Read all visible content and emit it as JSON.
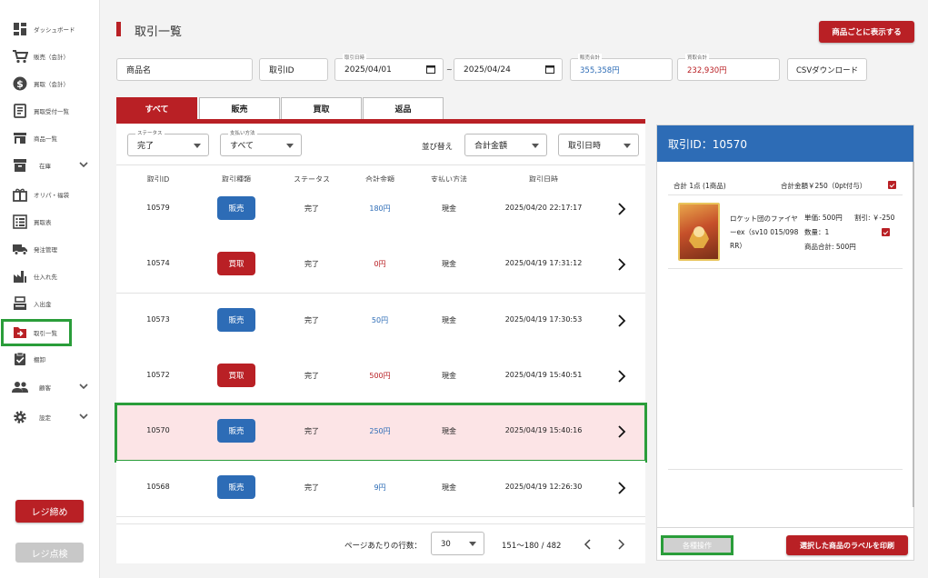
{
  "sidebar": {
    "items": [
      {
        "label": "ダッシュボード"
      },
      {
        "label": "販売（会計）"
      },
      {
        "label": "買取（会計）"
      },
      {
        "label": "買取受付一覧"
      },
      {
        "label": "商品一覧"
      },
      {
        "label": "在庫"
      },
      {
        "label": "オリパ・福袋"
      },
      {
        "label": "買取表"
      },
      {
        "label": "発注管理"
      },
      {
        "label": "仕入れ先"
      },
      {
        "label": "入出金"
      },
      {
        "label": "取引一覧"
      },
      {
        "label": "棚卸"
      },
      {
        "label": "顧客"
      },
      {
        "label": "設定"
      }
    ],
    "register_close_label": "レジ締め",
    "register_check_label": "レジ点検"
  },
  "header": {
    "title": "取引一覧",
    "show_by_product_label": "商品ごとに表示する"
  },
  "filters": {
    "product_name_placeholder": "商品名",
    "transaction_id_placeholder": "取引ID",
    "date_label": "取引日時",
    "date_from": "2025/04/01",
    "date_sep": "~",
    "date_to": "2025/04/24",
    "sales_total_label": "販売合計",
    "sales_total_value": "355,358円",
    "purchase_total_label": "買取合計",
    "purchase_total_value": "232,930円",
    "csv_label": "CSVダウンロード"
  },
  "tabs": [
    {
      "label": "すべて"
    },
    {
      "label": "販売"
    },
    {
      "label": "買取"
    },
    {
      "label": "返品"
    }
  ],
  "list_controls": {
    "status_label": "ステータス",
    "status_value": "完了",
    "payment_label": "支払い方法",
    "payment_value": "すべて",
    "sort_label": "並び替え",
    "sort_primary": "合計金額",
    "sort_secondary": "取引日時"
  },
  "table": {
    "headers": [
      "取引ID",
      "取引種類",
      "ステータス",
      "合計金額",
      "支払い方法",
      "取引日時"
    ],
    "rows": [
      {
        "id": "10579",
        "type": "販売",
        "status": "完了",
        "amount": "180円",
        "payment": "現金",
        "datetime": "2025/04/20 22:17:17"
      },
      {
        "id": "10574",
        "type": "買取",
        "status": "完了",
        "amount": "0円",
        "payment": "現金",
        "datetime": "2025/04/19 17:31:12"
      },
      {
        "id": "10573",
        "type": "販売",
        "status": "完了",
        "amount": "50円",
        "payment": "現金",
        "datetime": "2025/04/19 17:30:53"
      },
      {
        "id": "10572",
        "type": "買取",
        "status": "完了",
        "amount": "500円",
        "payment": "現金",
        "datetime": "2025/04/19 15:40:51"
      },
      {
        "id": "10570",
        "type": "販売",
        "status": "完了",
        "amount": "250円",
        "payment": "現金",
        "datetime": "2025/04/19 15:40:16"
      },
      {
        "id": "10568",
        "type": "販売",
        "status": "完了",
        "amount": "9円",
        "payment": "現金",
        "datetime": "2025/04/19 12:26:30"
      }
    ]
  },
  "pagination": {
    "rows_per_page_label": "ページあたりの行数：",
    "rows_per_page_value": "30",
    "range": "151〜180 / 482"
  },
  "detail": {
    "title": "取引ID：10570",
    "summary_count": "合計 1点 (1商品)",
    "summary_total": "合計金額￥250（0pt付与）",
    "item_name": "ロケット団のファイヤーex（sv10 015/098 RR）",
    "unit_price": "単価: 500円",
    "discount": "割引: ￥-250",
    "quantity": "数量：1",
    "item_total": "商品合計: 500円",
    "actions_label": "各種操作",
    "print_label": "選択した商品のラベルを印刷"
  },
  "colors": {
    "brand_red": "#b92025",
    "sale_blue": "#2d6cb6",
    "highlight_green": "#2a9d3a"
  }
}
